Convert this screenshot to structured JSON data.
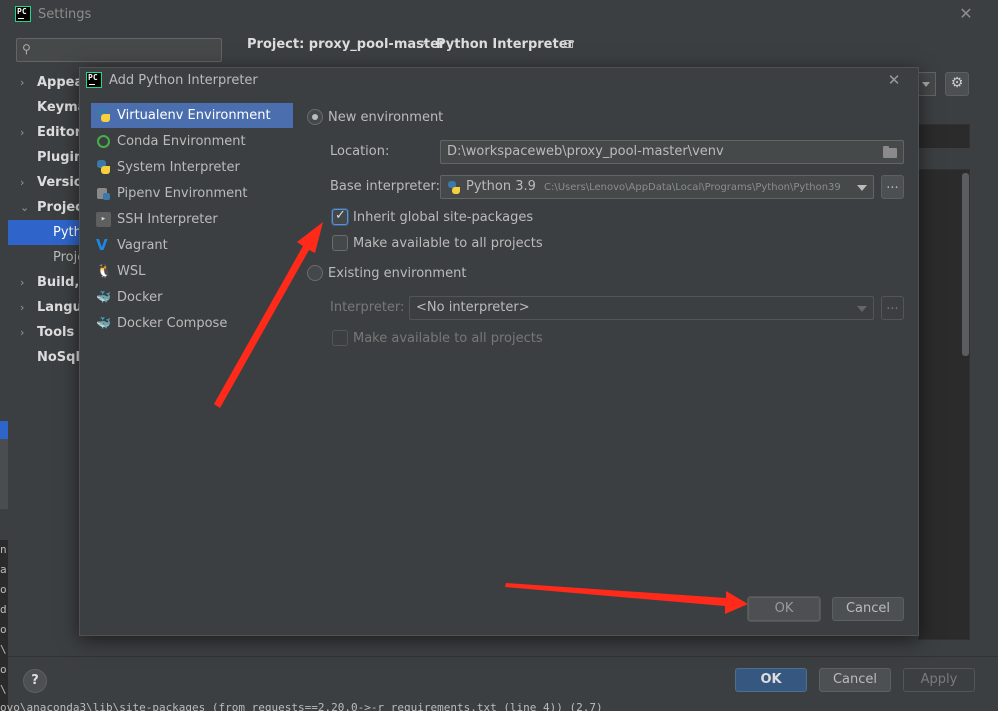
{
  "settings": {
    "title": "Settings",
    "logo_text": "PC",
    "close_glyph": "✕",
    "search": {
      "placeholder": "",
      "value": ""
    },
    "nav": [
      {
        "label": "Appear",
        "chevron": "›"
      },
      {
        "label": "Keyma",
        "chevron": ""
      },
      {
        "label": "Editor",
        "chevron": "›"
      },
      {
        "label": "Plugin",
        "chevron": ""
      },
      {
        "label": "Versio",
        "chevron": "›"
      },
      {
        "label": "Project",
        "chevron": "⌄"
      },
      {
        "label": "Build, I",
        "chevron": "›"
      },
      {
        "label": "Langua",
        "chevron": "›"
      },
      {
        "label": "Tools",
        "chevron": "›"
      },
      {
        "label": "NoSql",
        "chevron": ""
      }
    ],
    "nav_sub": [
      {
        "label": "Pytho",
        "selected": true
      },
      {
        "label": "Proje",
        "selected": false
      }
    ],
    "breadcrumb": {
      "project": "Project: proxy_pool-master",
      "separator": "›",
      "page": "Python Interpreter"
    },
    "gear_glyph": "⚙",
    "help_glyph": "?",
    "buttons": {
      "ok": "OK",
      "cancel": "Cancel",
      "apply": "Apply"
    },
    "console_letters": [
      "n",
      "a",
      "o",
      "d",
      "o",
      "\\",
      "o",
      "\\"
    ],
    "console_line": "ovo\\anaconda3\\lib\\site-packages (from requests==2.20.0->-r requirements.txt (line 4)) (2.7)"
  },
  "dialog": {
    "title": "Add Python Interpreter",
    "logo_text": "PC",
    "close_glyph": "✕",
    "types": [
      {
        "label": "Virtualenv Environment",
        "icon": "python-icon",
        "selected": true
      },
      {
        "label": "Conda Environment",
        "icon": "conda-icon",
        "selected": false
      },
      {
        "label": "System Interpreter",
        "icon": "python-icon",
        "selected": false
      },
      {
        "label": "Pipenv Environment",
        "icon": "pipenv-icon",
        "selected": false
      },
      {
        "label": "SSH Interpreter",
        "icon": "ssh-icon",
        "selected": false
      },
      {
        "label": "Vagrant",
        "icon": "vagrant-icon",
        "selected": false
      },
      {
        "label": "WSL",
        "icon": "wsl-icon",
        "selected": false
      },
      {
        "label": "Docker",
        "icon": "docker-icon",
        "selected": false
      },
      {
        "label": "Docker Compose",
        "icon": "docker-compose-icon",
        "selected": false
      }
    ],
    "new_env": {
      "radio_label": "New environment",
      "selected": true,
      "location_label": "Location:",
      "location_value": "D:\\workspaceweb\\proxy_pool-master\\venv",
      "base_label": "Base interpreter:",
      "base_name": "Python 3.9",
      "base_path": "C:\\Users\\Lenovo\\AppData\\Local\\Programs\\Python\\Python39",
      "browse_glyph": "...",
      "inherit_label": "Inherit global site-packages",
      "inherit_checked": true,
      "make_available_label": "Make available to all projects",
      "make_available_checked": false
    },
    "existing_env": {
      "radio_label": "Existing environment",
      "selected": false,
      "interpreter_label": "Interpreter:",
      "interpreter_value": "<No interpreter>",
      "browse_glyph": "...",
      "make_available_label": "Make available to all projects"
    },
    "buttons": {
      "ok": "OK",
      "cancel": "Cancel"
    }
  },
  "annotation_color": "#ff2a1a"
}
